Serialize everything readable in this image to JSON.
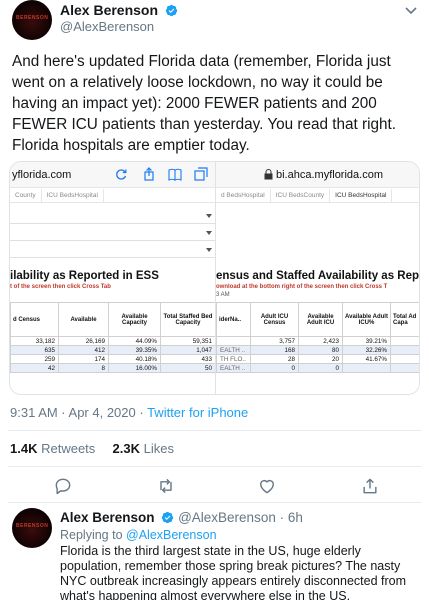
{
  "tweet": {
    "author_name": "Alex Berenson",
    "author_handle": "@AlexBerenson",
    "avatar_text": "BERENSON",
    "text": "And here's updated Florida data (remember, Florida just went on a relatively loose lockdown, no way it could be having an impact yet): 2000 FEWER patients and 200 FEWER ICU patients than yesterday. You read that right. Florida hospitals are emptier today.",
    "time": "9:31 AM · Apr 4, 2020 · ",
    "source": "Twitter for iPhone",
    "retweets_count": "1.4K",
    "retweets_label": "Retweets",
    "likes_count": "2.3K",
    "likes_label": "Likes"
  },
  "screenshot_left": {
    "url": "yflorida.com",
    "tabs": [
      "County",
      "ICU BedsHospital"
    ],
    "report_title": "ilability as Reported in ESS",
    "report_sub": "t of the screen then click Cross Tab",
    "headers": [
      "d Census",
      "Available",
      "Available Capacity",
      "Total Staffed Bed Capacity"
    ],
    "rows": [
      [
        "33,182",
        "26,169",
        "44.09%",
        "59,351"
      ],
      [
        "635",
        "412",
        "39.35%",
        "1,047"
      ],
      [
        "259",
        "174",
        "40.18%",
        "433"
      ],
      [
        "42",
        "8",
        "16.00%",
        "50"
      ]
    ]
  },
  "screenshot_right": {
    "url": "bi.ahca.myflorida.com",
    "tabs": [
      "d BedsHospital",
      "ICU BedsCounty",
      "ICU BedsHospital"
    ],
    "report_title": "ensus and Staffed Availability as Report",
    "report_sub": "ownload at the bottom right of the screen then click Cross T",
    "report_time": "3 AM",
    "headers": [
      "iderNa..",
      "Adult ICU Census",
      "Available Adult ICU",
      "Available Adult ICU%",
      "Total Ad Capa"
    ],
    "rows": [
      [
        "",
        "3,757",
        "2,423",
        "39.21%",
        ""
      ],
      [
        "EALTH ..",
        "168",
        "80",
        "32.26%",
        ""
      ],
      [
        "TH FLO..",
        "28",
        "20",
        "41.67%",
        ""
      ],
      [
        "EALTH ..",
        "0",
        "0",
        "",
        ""
      ]
    ]
  },
  "reply": {
    "author_name": "Alex Berenson",
    "meta": "@AlexBerenson · 6h",
    "replying_prefix": "Replying to ",
    "replying_to": "@AlexBerenson",
    "text": "Florida is the third largest state in the US, huge elderly population, remember those spring break pictures? The nasty NYC outbreak increasingly appears entirely disconnected from what's happening almost everywhere else in the US."
  },
  "colors": {
    "link": "#1da1f2",
    "muted": "#657786",
    "verified": "#1da1f2",
    "table_stripe": "#e8eef7"
  },
  "icons": [
    "verified-badge-icon",
    "more-chevron-icon",
    "lock-icon",
    "reload-icon",
    "share-icon",
    "bookmark-icon",
    "tabs-icon",
    "reply-icon",
    "retweet-icon",
    "like-icon",
    "share-icon"
  ]
}
